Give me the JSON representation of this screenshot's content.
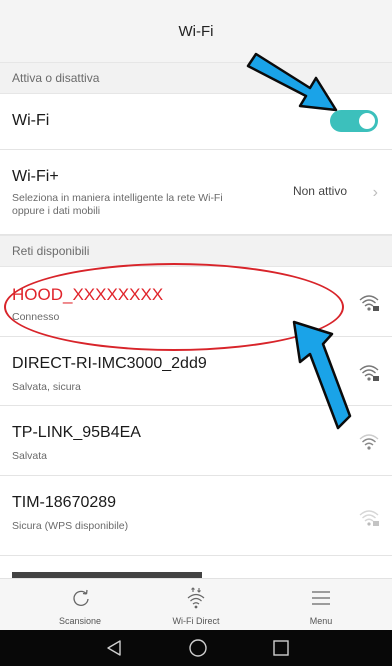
{
  "header": {
    "title": "Wi-Fi"
  },
  "section_toggle": {
    "label": "Attiva o disattiva"
  },
  "wifi_row": {
    "label": "Wi-Fi",
    "enabled": true
  },
  "wifi_plus": {
    "title": "Wi-Fi+",
    "description_line1": "Seleziona in maniera intelligente la rete Wi-Fi",
    "description_line2": "oppure i dati mobili",
    "status": "Non attivo"
  },
  "section_networks": {
    "label": "Reti disponibili"
  },
  "networks": [
    {
      "name": "HOOD_XXXXXXXX",
      "status": "Connesso",
      "icon": "wifi-locked-icon",
      "signal": 4
    },
    {
      "name": "DIRECT-RI-IMC3000_2dd9",
      "status": "Salvata, sicura",
      "icon": "wifi-locked-icon",
      "signal": 4
    },
    {
      "name": "TP-LINK_95B4EA",
      "status": "Salvata",
      "icon": "wifi-icon",
      "signal": 3
    },
    {
      "name": "TIM-18670289",
      "status": "Sicura (WPS disponibile)",
      "icon": "wifi-locked-icon",
      "signal": 1
    }
  ],
  "bottom_bar": {
    "scan_label": "Scansione",
    "direct_label": "Wi-Fi Direct",
    "menu_label": "Menu"
  },
  "colors": {
    "toggle_on": "#3cc0bc",
    "highlight": "#e0242b",
    "annotation_arrow": "#1aa3e8"
  }
}
